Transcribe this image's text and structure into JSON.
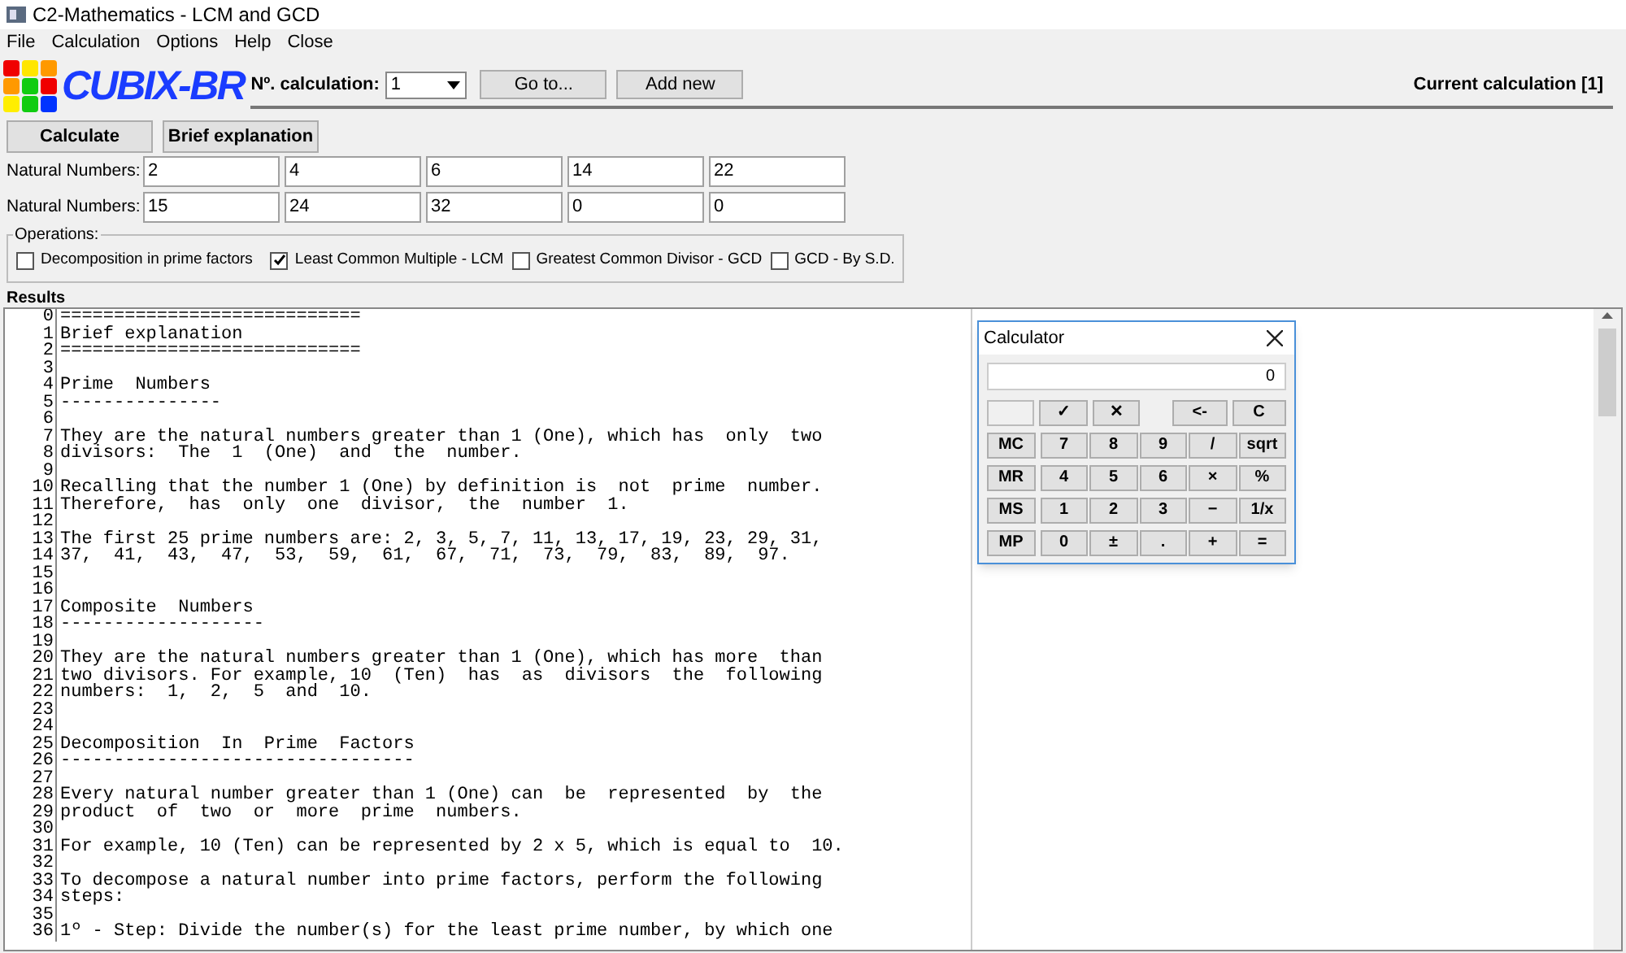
{
  "window": {
    "title": "C2-Mathematics - LCM and GCD"
  },
  "menu": [
    "File",
    "Calculation",
    "Options",
    "Help",
    "Close"
  ],
  "toolbar": {
    "logo_text": "CUBIX-BR",
    "calc_label": "Nº. calculation:",
    "calc_value": "1",
    "buttons": [
      "Go to...",
      "Add new"
    ],
    "current": "Current calculation [1]"
  },
  "actions": [
    "Calculate",
    "Brief explanation"
  ],
  "number_rows": [
    {
      "label": "Natural Numbers:",
      "values": [
        "2",
        "4",
        "6",
        "14",
        "22"
      ]
    },
    {
      "label": "Natural Numbers:",
      "values": [
        "15",
        "24",
        "32",
        "0",
        "0"
      ]
    }
  ],
  "operations": {
    "title": "Operations:",
    "options": [
      {
        "label": "Decomposition in prime factors",
        "checked": false
      },
      {
        "label": "Least Common Multiple - LCM",
        "checked": true
      },
      {
        "label": "Greatest Common Divisor - GCD",
        "checked": false
      },
      {
        "label": "GCD - By S.D.",
        "checked": false
      }
    ]
  },
  "results": {
    "title": "Results",
    "lines": [
      {
        "number": "0",
        "text": "============================"
      },
      {
        "number": "1",
        "text": "Brief explanation"
      },
      {
        "number": "2",
        "text": "============================"
      },
      {
        "number": "3"
      },
      {
        "number": "4",
        "text": "Prime  Numbers"
      },
      {
        "number": "5",
        "text": "---------------"
      },
      {
        "number": "6"
      },
      {
        "number": "7",
        "text": "They are the natural numbers greater than 1 (One), which has  only  two"
      },
      {
        "number": "8",
        "text": "divisors:  The  1  (One)  and  the  number."
      },
      {
        "number": "9"
      },
      {
        "number": "10",
        "text": "Recalling that the number 1 (One) by definition is  not  prime  number."
      },
      {
        "number": "11",
        "text": "Therefore,  has  only  one  divisor,  the  number  1."
      },
      {
        "number": "12"
      },
      {
        "number": "13",
        "text": "The first 25 prime numbers are: 2, 3, 5, 7, 11, 13, 17, 19, 23, 29, 31,"
      },
      {
        "number": "14",
        "text": "37,  41,  43,  47,  53,  59,  61,  67,  71,  73,  79,  83,  89,  97."
      },
      {
        "number": "15"
      },
      {
        "number": "16"
      },
      {
        "number": "17",
        "text": "Composite  Numbers"
      },
      {
        "number": "18",
        "text": "-------------------"
      },
      {
        "number": "19"
      },
      {
        "number": "20",
        "text": "They are the natural numbers greater than 1 (One), which has more  than"
      },
      {
        "number": "21",
        "text": "two divisors. For example, 10  (Ten)  has  as  divisors  the  following"
      },
      {
        "number": "22",
        "text": "numbers:  1,  2,  5  and  10."
      },
      {
        "number": "23"
      },
      {
        "number": "24"
      },
      {
        "number": "25",
        "text": "Decomposition  In  Prime  Factors"
      },
      {
        "number": "26",
        "text": "---------------------------------"
      },
      {
        "number": "27"
      },
      {
        "number": "28",
        "text": "Every natural number greater than 1 (One) can  be  represented  by  the"
      },
      {
        "number": "29",
        "text": "product  of  two  or  more  prime  numbers."
      },
      {
        "number": "30"
      },
      {
        "number": "31",
        "text": "For example, 10 (Ten) can be represented by 2 x 5, which is equal to  10."
      },
      {
        "number": "32"
      },
      {
        "number": "33",
        "text": "To decompose a natural number into prime factors, perform the following"
      },
      {
        "number": "34",
        "text": "steps:"
      },
      {
        "number": "35"
      },
      {
        "number": "36",
        "text": "1º - Step: Divide the number(s) for the least prime number, by which one"
      }
    ]
  },
  "calculator": {
    "title": "Calculator",
    "display": "0",
    "top_keys": [
      "✓",
      "✕",
      "<-",
      "C"
    ],
    "rows": [
      [
        "MC",
        "7",
        "8",
        "9",
        "/",
        "sqrt"
      ],
      [
        "MR",
        "4",
        "5",
        "6",
        "×",
        "%"
      ],
      [
        "MS",
        "1",
        "2",
        "3",
        "−",
        "1/x"
      ],
      [
        "MP",
        "0",
        "±",
        ".",
        "+",
        "="
      ]
    ]
  }
}
